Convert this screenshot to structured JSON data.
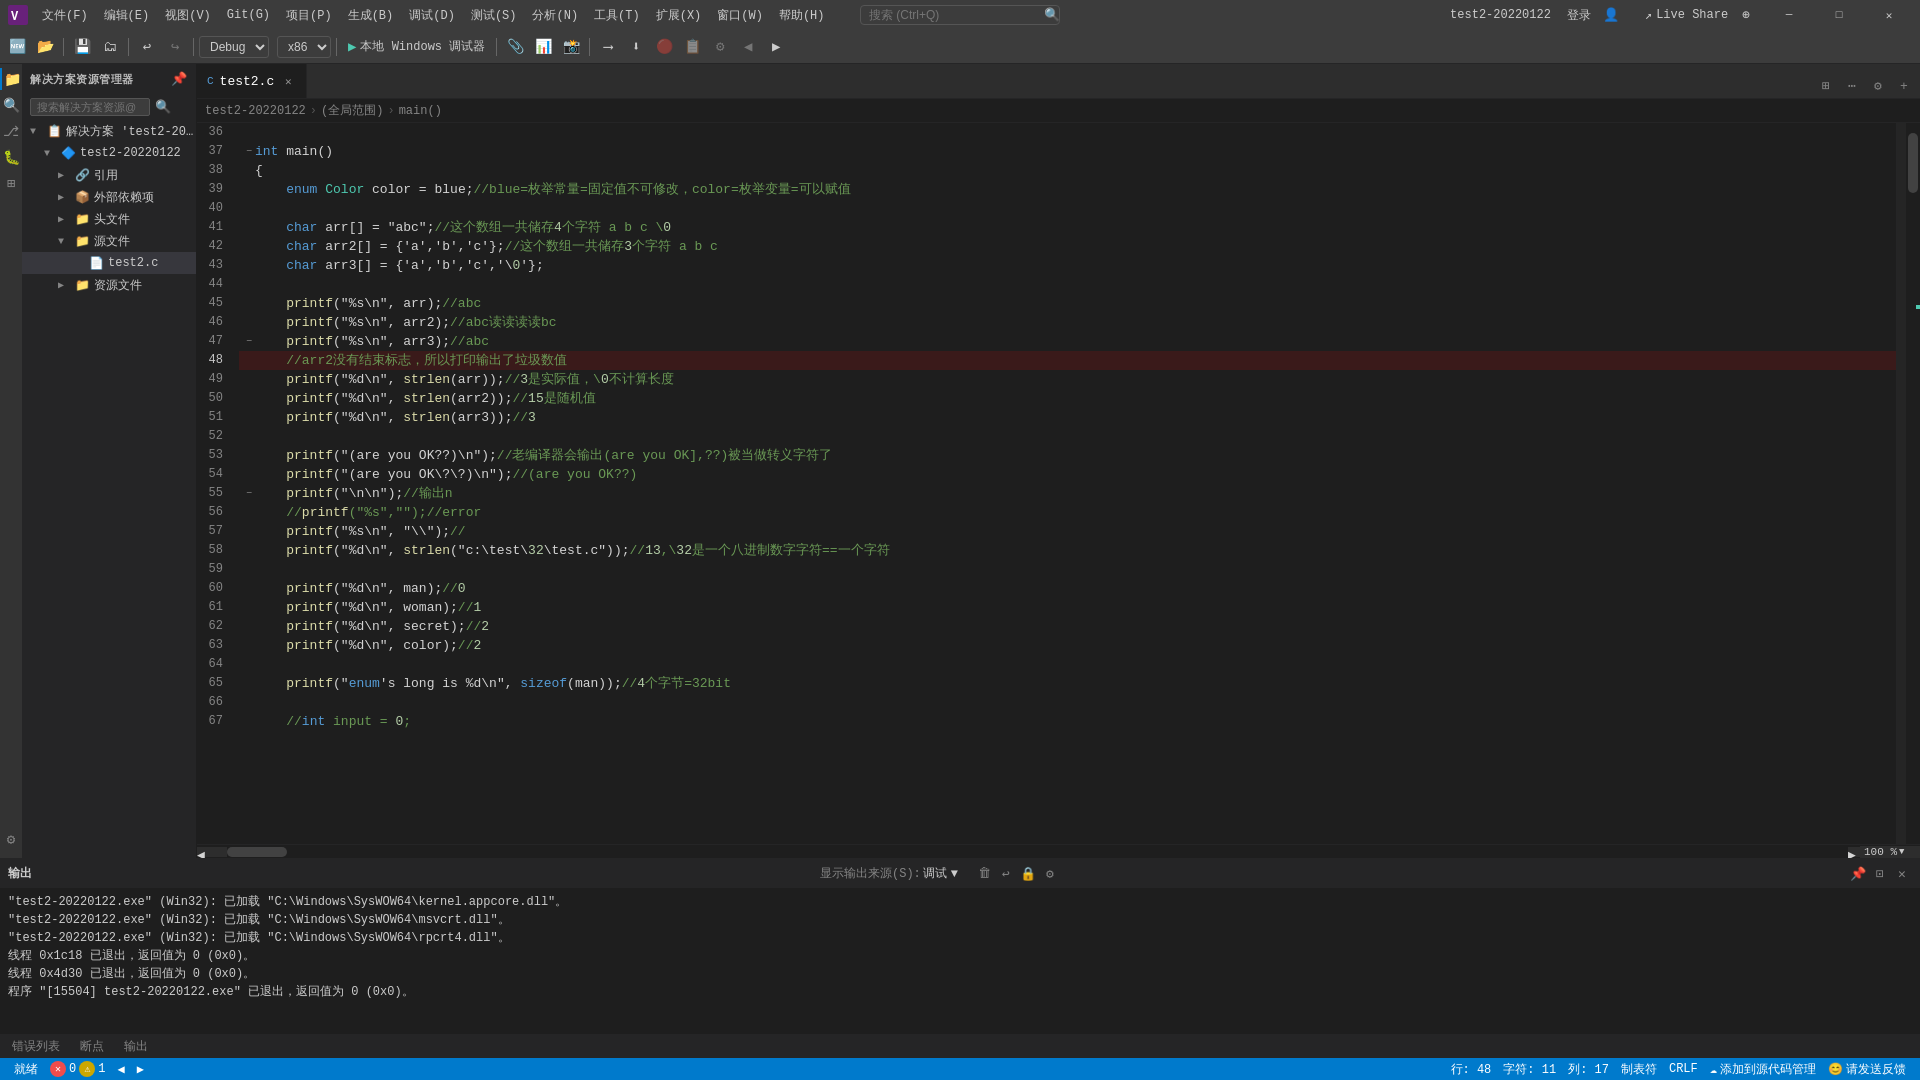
{
  "titleBar": {
    "title": "test2-20220122",
    "searchPlaceholder": "搜索 (Ctrl+Q)",
    "loginLabel": "登录",
    "menus": [
      "文件(F)",
      "编辑(E)",
      "视图(V)",
      "Git(G)",
      "项目(P)",
      "生成(B)",
      "调试(D)",
      "测试(S)",
      "分析(N)",
      "工具(T)",
      "扩展(X)",
      "窗口(W)",
      "帮助(H)"
    ]
  },
  "toolbar": {
    "debugMode": "Debug",
    "platform": "x86",
    "runLabel": "本地 Windows 调试器",
    "liveShare": "Live Share"
  },
  "sidebar": {
    "header": "解决方案资源管理器",
    "searchPlaceholder": "搜索解决方案资源@",
    "tree": [
      {
        "label": "解决方案 'test2-202…'",
        "level": 0,
        "expanded": true,
        "icon": "📁"
      },
      {
        "label": "test2-20220122",
        "level": 1,
        "expanded": true,
        "icon": "📁"
      },
      {
        "label": "引用",
        "level": 2,
        "expanded": false,
        "icon": "📁"
      },
      {
        "label": "外部依赖项",
        "level": 2,
        "expanded": false,
        "icon": "📁"
      },
      {
        "label": "头文件",
        "level": 2,
        "expanded": false,
        "icon": "📁"
      },
      {
        "label": "源文件",
        "level": 2,
        "expanded": true,
        "icon": "📁"
      },
      {
        "label": "test2.c",
        "level": 3,
        "expanded": false,
        "icon": "📄"
      },
      {
        "label": "资源文件",
        "level": 2,
        "expanded": false,
        "icon": "📁"
      }
    ]
  },
  "editor": {
    "filename": "test2.c",
    "breadcrumb": [
      "test2-20220122",
      "(全局范围)",
      "main()"
    ],
    "lines": [
      {
        "num": 36,
        "content": ""
      },
      {
        "num": 37,
        "content": "int main()",
        "fold": true
      },
      {
        "num": 38,
        "content": "{"
      },
      {
        "num": 39,
        "content": "    enum Color color = blue;//blue=枚举常量=固定值不可修改，color=枚举变量=可以赋值"
      },
      {
        "num": 40,
        "content": ""
      },
      {
        "num": 41,
        "content": "    char arr[] = \"abc\";//这个数组一共储存4个字符 a b c \\0"
      },
      {
        "num": 42,
        "content": "    char arr2[] = {'a','b','c'};//这个数组一共储存3个字符 a b c"
      },
      {
        "num": 43,
        "content": "    char arr3[] = {'a','b','c','\\0'};"
      },
      {
        "num": 44,
        "content": ""
      },
      {
        "num": 45,
        "content": "    printf(\"%s\\n\", arr);//abc"
      },
      {
        "num": 46,
        "content": "    printf(\"%s\\n\", arr2);//abc读读读读bc"
      },
      {
        "num": 47,
        "content": "    printf(\"%s\\n\", arr3);//abc",
        "fold": true
      },
      {
        "num": 48,
        "content": "    //arr2没有结束标志，所以打印输出了垃圾数值",
        "highlighted": true,
        "error": true
      },
      {
        "num": 49,
        "content": "    printf(\"%d\\n\", strlen(arr));//3是实际值，\\0不计算长度"
      },
      {
        "num": 50,
        "content": "    printf(\"%d\\n\", strlen(arr2));//15是随机值"
      },
      {
        "num": 51,
        "content": "    printf(\"%d\\n\", strlen(arr3));//3"
      },
      {
        "num": 52,
        "content": ""
      },
      {
        "num": 53,
        "content": "    printf(\"(are you OK??)\\n\");//老编译器会输出(are you OK],??)被当做转义字符了"
      },
      {
        "num": 54,
        "content": "    printf(\"(are you OK\\?\\?)\\n\");//(are you OK??)"
      },
      {
        "num": 55,
        "content": "    printf(\"\\n\\n\");//输出n",
        "fold": true
      },
      {
        "num": 56,
        "content": "    //printf(\"%s\",\"\");//error"
      },
      {
        "num": 57,
        "content": "    printf(\"%s\\n\", \"\\\\\");//"
      },
      {
        "num": 58,
        "content": "    printf(\"%d\\n\", strlen(\"c:\\test\\32\\test.c\"));//13,\\32是一个八进制数字字符==一个字符"
      },
      {
        "num": 59,
        "content": ""
      },
      {
        "num": 60,
        "content": "    printf(\"%d\\n\", man);//0"
      },
      {
        "num": 61,
        "content": "    printf(\"%d\\n\", woman);//1"
      },
      {
        "num": 62,
        "content": "    printf(\"%d\\n\", secret);//2"
      },
      {
        "num": 63,
        "content": "    printf(\"%d\\n\", color);//2"
      },
      {
        "num": 64,
        "content": ""
      },
      {
        "num": 65,
        "content": "    printf(\"enum's long is %d\\n\", sizeof(man));//4个字节=32bit"
      },
      {
        "num": 66,
        "content": ""
      },
      {
        "num": 67,
        "content": "    //int input = 0;"
      }
    ]
  },
  "statusBar": {
    "gitBranch": "就绪",
    "errors": "0",
    "warnings": "1",
    "row": "行: 48",
    "col": "字符: 11",
    "colNum": "列: 17",
    "encoding": "制表符",
    "lineEnding": "CRLF",
    "addToCloud": "添加到源代码管理",
    "feedback": "请发送反馈"
  },
  "outputPanel": {
    "title": "输出",
    "sourceLabel": "显示输出来源(S):",
    "sourceValue": "调试",
    "tabs": [
      "错误列表",
      "断点",
      "输出"
    ],
    "content": "\"test2-20220122.exe\" (Win32): 已加载 \"C:\\Windows\\SysWOW64\\kernel.appcore.dll\"。\n\"test2-20220122.exe\" (Win32): 已加载 \"C:\\Windows\\SysWOW64\\msvcrt.dll\"。\n\"test2-20220122.exe\" (Win32): 已加载 \"C:\\Windows\\SysWOW64\\rpcrt4.dll\"。\n线程 0x1c18 已退出，返回值为 0 (0x0)。\n线程 0x4d30 已退出，返回值为 0 (0x0)。\n程序 \"[15504] test2-20220122.exe\" 已退出，返回值为 0 (0x0)。"
  }
}
